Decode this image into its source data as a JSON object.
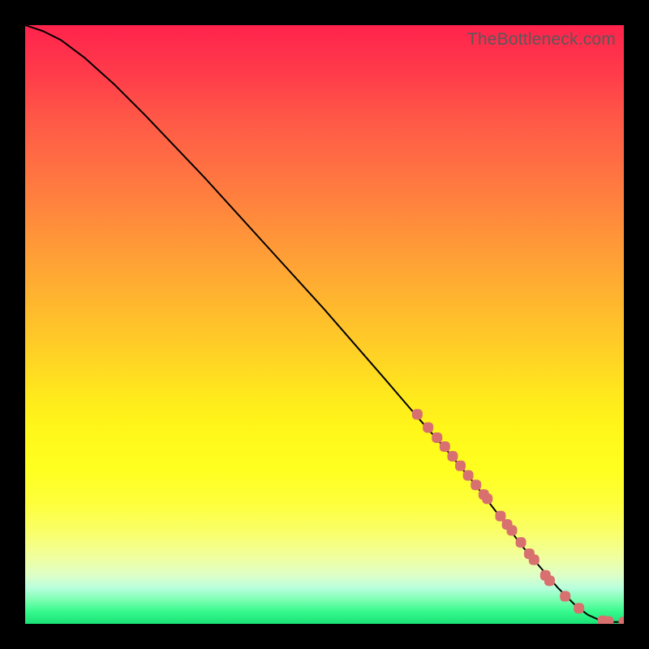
{
  "watermark": "TheBottleneck.com",
  "colors": {
    "frame": "#000000",
    "point": "#d87070",
    "curve": "#000000"
  },
  "chart_data": {
    "type": "line",
    "title": "",
    "xlabel": "",
    "ylabel": "",
    "xlim": [
      0,
      100
    ],
    "ylim": [
      0,
      100
    ],
    "grid": false,
    "legend": false,
    "series": [
      {
        "name": "curve",
        "x": [
          0,
          3,
          6,
          10,
          15,
          20,
          30,
          40,
          50,
          60,
          66,
          70,
          75,
          80,
          83,
          86,
          89,
          92,
          94,
          96,
          97.5,
          100
        ],
        "y": [
          100,
          99,
          97.5,
          94.5,
          90,
          85,
          74.5,
          63.5,
          52.5,
          41,
          34,
          29.5,
          23.5,
          17,
          13,
          9.5,
          6,
          3,
          1.5,
          0.6,
          0.3,
          0.3
        ]
      }
    ],
    "scatter_points": {
      "name": "highlighted-points",
      "style": "rounded-marker",
      "x": [
        65.5,
        67.3,
        68.8,
        70.1,
        71.4,
        72.7,
        74.0,
        75.3,
        76.6,
        77.2,
        79.4,
        80.5,
        81.3,
        82.8,
        84.2,
        85.0,
        86.9,
        87.6,
        90.2,
        92.5,
        96.5,
        97.4,
        100.0
      ],
      "y": [
        35.0,
        32.8,
        31.1,
        29.6,
        28.0,
        26.4,
        24.8,
        23.2,
        21.6,
        20.9,
        18.0,
        16.6,
        15.6,
        13.6,
        11.7,
        10.7,
        8.1,
        7.2,
        4.6,
        2.6,
        0.5,
        0.4,
        0.3
      ]
    }
  }
}
